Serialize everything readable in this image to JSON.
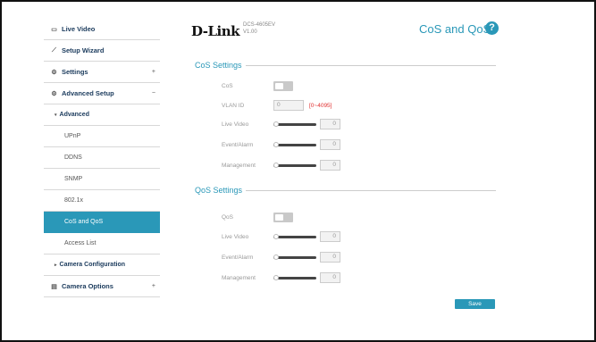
{
  "header": {
    "logo": "D-Link",
    "model": "DCS-4605EV",
    "version": "V1.00",
    "page_title": "CoS and QoS",
    "help_symbol": "?"
  },
  "sidebar": {
    "items": [
      {
        "label": "Live Video",
        "icon": "video-icon",
        "glyph": "▭"
      },
      {
        "label": "Setup Wizard",
        "icon": "wand-icon",
        "glyph": "⟋"
      },
      {
        "label": "Settings",
        "icon": "gear-icon",
        "glyph": "⚙",
        "toggle": "+"
      },
      {
        "label": "Advanced Setup",
        "icon": "gears-icon",
        "glyph": "⚙",
        "toggle": "−"
      },
      {
        "label": "Advanced",
        "caret": "▾"
      },
      {
        "label": "UPnP"
      },
      {
        "label": "DDNS"
      },
      {
        "label": "SNMP"
      },
      {
        "label": "802.1x"
      },
      {
        "label": "CoS and QoS",
        "active": true
      },
      {
        "label": "Access List"
      },
      {
        "label": "Camera Configuration",
        "caret": "▸"
      },
      {
        "label": "Camera Options",
        "icon": "document-icon",
        "glyph": "▤",
        "toggle": "+"
      }
    ]
  },
  "cos": {
    "title": "CoS Settings",
    "cos_label": "CoS",
    "cos_enabled": false,
    "vlan_label": "VLAN ID",
    "vlan_value": "0",
    "vlan_range": "[0~4095]",
    "live_video_label": "Live Video",
    "live_video_value": "0",
    "event_alarm_label": "Event/Alarm",
    "event_alarm_value": "0",
    "management_label": "Management",
    "management_value": "0"
  },
  "qos": {
    "title": "QoS Settings",
    "qos_label": "QoS",
    "qos_enabled": false,
    "live_video_label": "Live Video",
    "live_video_value": "0",
    "event_alarm_label": "Event/Alarm",
    "event_alarm_value": "0",
    "management_label": "Management",
    "management_value": "0"
  },
  "actions": {
    "save_label": "Save"
  },
  "colors": {
    "accent": "#2a98b8",
    "range_hint": "#e03030"
  }
}
